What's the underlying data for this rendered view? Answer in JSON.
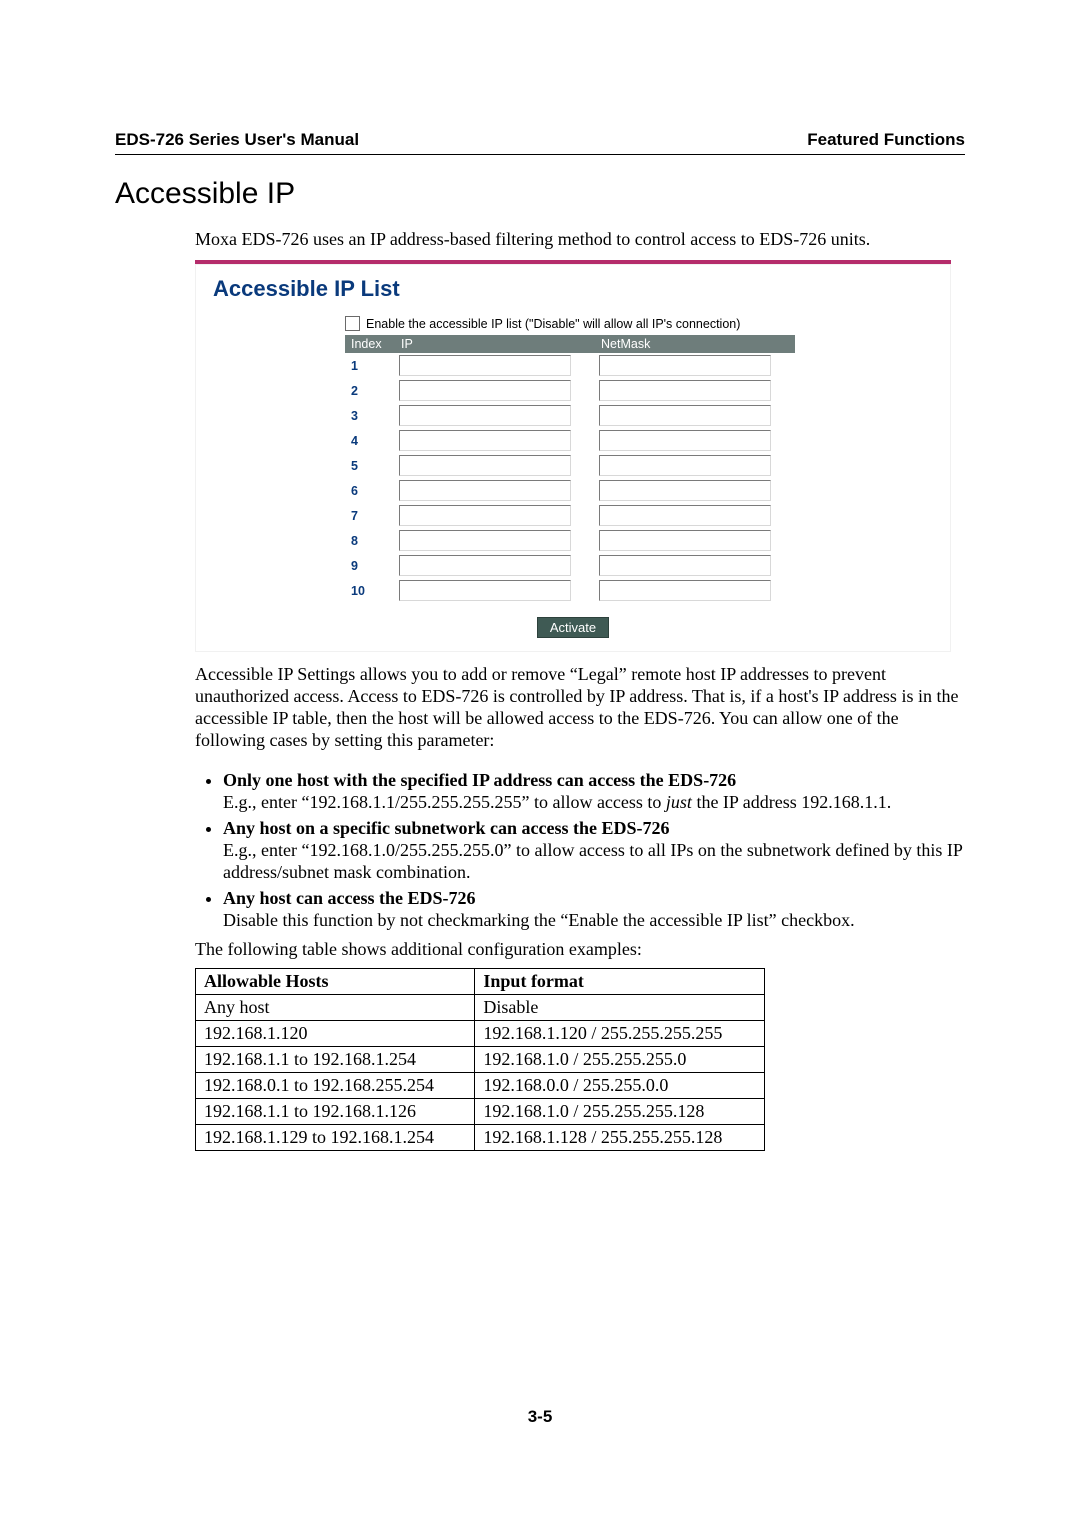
{
  "header": {
    "left": "EDS-726 Series User's Manual",
    "right": "Featured Functions"
  },
  "heading": "Accessible IP",
  "intro": "Moxa EDS-726 uses an IP address-based filtering method to control access to EDS-726 units.",
  "panel": {
    "title": "Accessible IP List",
    "enable_label": "Enable the accessible IP list (\"Disable\" will allow all IP's connection)",
    "columns": {
      "index": "Index",
      "ip": "IP",
      "netmask": "NetMask"
    },
    "rows": [
      "1",
      "2",
      "3",
      "4",
      "5",
      "6",
      "7",
      "8",
      "9",
      "10"
    ],
    "activate": "Activate"
  },
  "para1": "Accessible IP Settings allows you to add or remove “Legal” remote host IP addresses to prevent unauthorized access. Access to EDS-726 is controlled by IP address. That is, if a host's IP address is in the accessible IP table, then the host will be allowed access to the EDS-726. You can allow one of the following cases by setting this parameter:",
  "bullets": [
    {
      "title": "Only one host with the specified IP address can access the EDS-726",
      "text_a": "E.g., enter “192.168.1.1/255.255.255.255” to allow access to ",
      "italic": "just",
      "text_b": " the IP address 192.168.1.1."
    },
    {
      "title": "Any host on a specific subnetwork can access the EDS-726",
      "text_a": "E.g., enter “192.168.1.0/255.255.255.0” to allow access to all IPs on the subnetwork defined by this IP address/subnet mask combination.",
      "italic": "",
      "text_b": ""
    },
    {
      "title": "Any host can access the EDS-726",
      "text_a": "Disable this function by not checkmarking the “Enable the accessible IP list” checkbox.",
      "italic": "",
      "text_b": ""
    }
  ],
  "table_intro": "The following table shows additional configuration examples:",
  "examples": {
    "headers": {
      "hosts": "Allowable Hosts",
      "format": "Input format"
    },
    "rows": [
      {
        "hosts": "Any host",
        "format": "Disable"
      },
      {
        "hosts": "192.168.1.120",
        "format": "192.168.1.120 / 255.255.255.255"
      },
      {
        "hosts": "192.168.1.1 to 192.168.1.254",
        "format": "192.168.1.0 / 255.255.255.0"
      },
      {
        "hosts": "192.168.0.1 to 192.168.255.254",
        "format": "192.168.0.0 / 255.255.0.0"
      },
      {
        "hosts": "192.168.1.1 to 192.168.1.126",
        "format": "192.168.1.0 / 255.255.255.128"
      },
      {
        "hosts": "192.168.1.129 to 192.168.1.254",
        "format": "192.168.1.128 / 255.255.255.128"
      }
    ]
  },
  "page_number": "3-5"
}
